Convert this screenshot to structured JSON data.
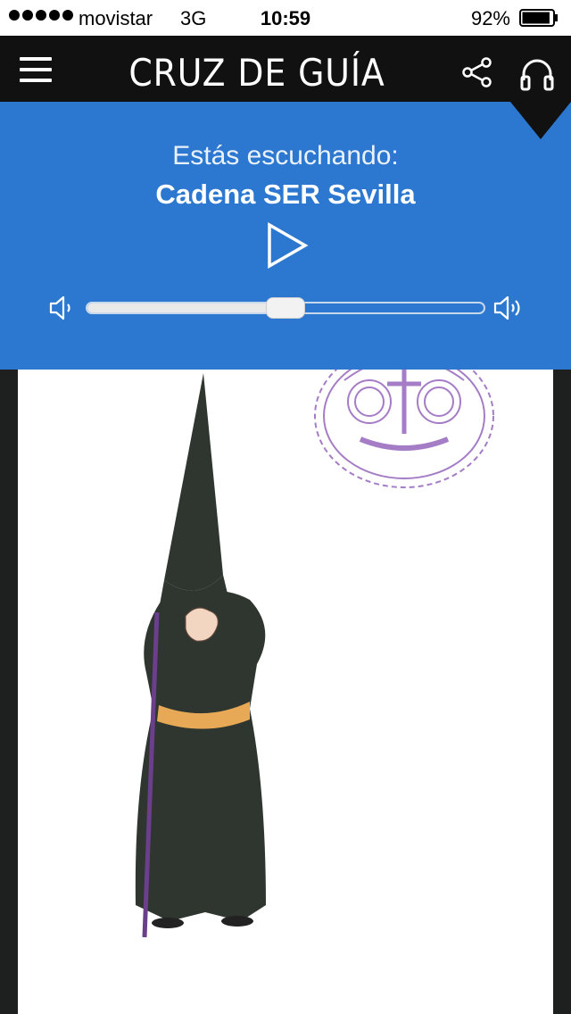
{
  "status_bar": {
    "carrier": "movistar",
    "network": "3G",
    "time": "10:59",
    "battery": "92%",
    "battery_level": 0.92
  },
  "header": {
    "title": "CRUZ DE GUÍA",
    "icons": [
      "menu-icon",
      "share-icon",
      "headphones-icon"
    ]
  },
  "player": {
    "listening_label": "Estás escuchando:",
    "station": "Cadena SER Sevilla",
    "volume_level": 0.5,
    "accent_color": "#2c78d0"
  },
  "content": {
    "images": [
      "nazareno-illustration",
      "brotherhood-crest"
    ]
  }
}
